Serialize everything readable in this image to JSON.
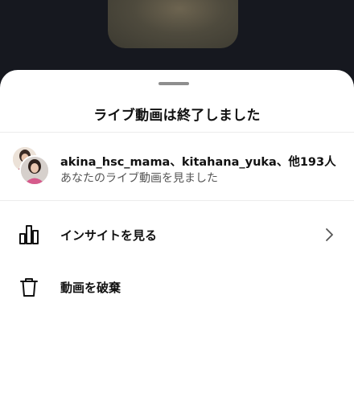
{
  "sheet": {
    "title": "ライブ動画は終了しました"
  },
  "viewers": {
    "names": "akina_hsc_mama、kitahana_yuka、他193人",
    "subtitle": "あなたのライブ動画を見ました"
  },
  "menu": {
    "insights_label": "インサイトを見る",
    "discard_label": "動画を破棄"
  },
  "icons": {
    "insights": "bar-chart-icon",
    "discard": "trash-icon",
    "chevron": "chevron-right-icon"
  }
}
